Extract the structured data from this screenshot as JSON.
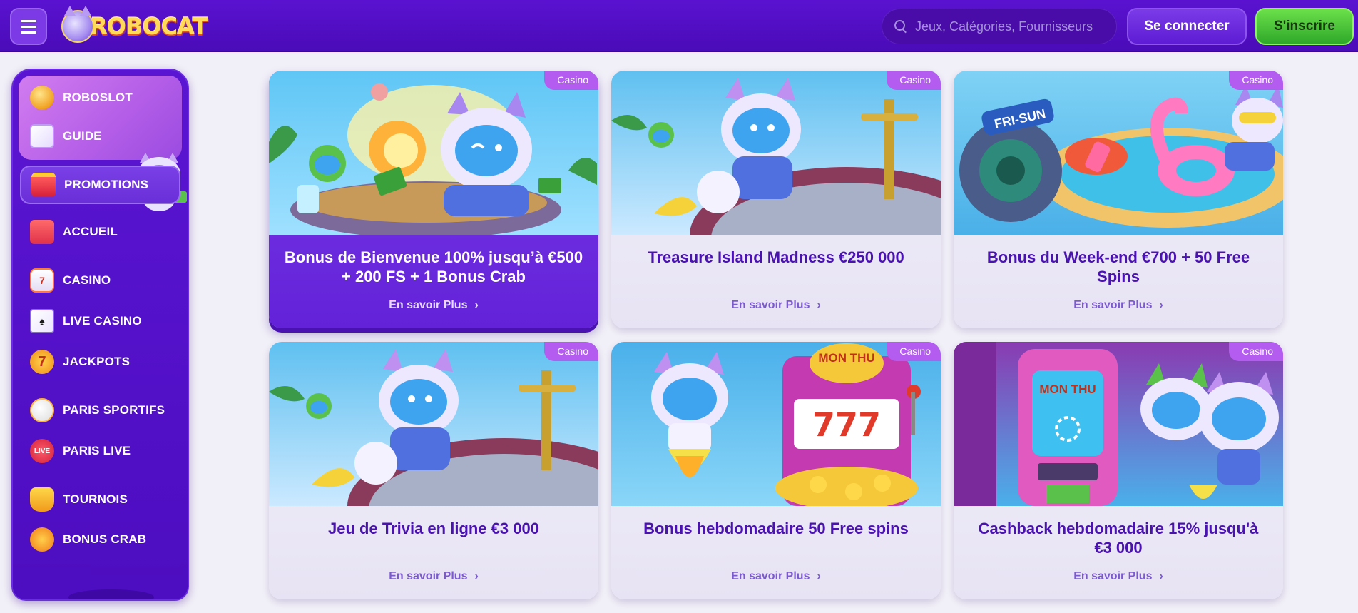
{
  "header": {
    "logo_text": "ROBOCAT",
    "search_placeholder": "Jeux, Catégories, Fournisseurs",
    "login_label": "Se connecter",
    "signup_label": "S'inscrire"
  },
  "sidebar": {
    "items": [
      {
        "label": "ROBOSLOT",
        "icon": "coin-icon"
      },
      {
        "label": "GUIDE",
        "icon": "guide-icon"
      },
      {
        "label": "PROMOTIONS",
        "icon": "gift-icon"
      },
      {
        "label": "ACCUEIL",
        "icon": "home-icon"
      },
      {
        "label": "CASINO",
        "icon": "slot-icon"
      },
      {
        "label": "LIVE CASINO",
        "icon": "cards-icon"
      },
      {
        "label": "JACKPOTS",
        "icon": "seven-icon"
      },
      {
        "label": "PARIS SPORTIFS",
        "icon": "football-icon"
      },
      {
        "label": "PARIS LIVE",
        "icon": "live-icon"
      },
      {
        "label": "TOURNOIS",
        "icon": "trophy-icon"
      },
      {
        "label": "BONUS CRAB",
        "icon": "crab-icon"
      }
    ]
  },
  "promos": [
    {
      "badge": "Casino",
      "title": "Bonus de Bienvenue 100% jusqu’à €500 + 200 FS + 1 Bonus Crab",
      "more": "En savoir Plus"
    },
    {
      "badge": "Casino",
      "title": "Treasure Island Madness €250 000",
      "more": "En savoir Plus"
    },
    {
      "badge": "Casino",
      "title": "Bonus du Week-end €700 + 50 Free Spins",
      "more": "En savoir Plus"
    },
    {
      "badge": "Casino",
      "title": "Jeu de Trivia en ligne €3 000",
      "more": "En savoir Plus"
    },
    {
      "badge": "Casino",
      "title": "Bonus hebdomadaire 50 Free spins",
      "more": "En savoir Plus"
    },
    {
      "badge": "Casino",
      "title": "Cashback hebdomadaire 15% jusqu'à €3 000",
      "more": "En savoir Plus"
    }
  ],
  "art_text": {
    "frisun": "FRI-SUN",
    "monthu": "MON THU",
    "sevens": "777"
  },
  "colors": {
    "header": "#5a12d0",
    "sidebar": "#5a15d2",
    "signup": "#3fbf35",
    "badge": "#b45cf0",
    "title": "#4a12b0"
  }
}
